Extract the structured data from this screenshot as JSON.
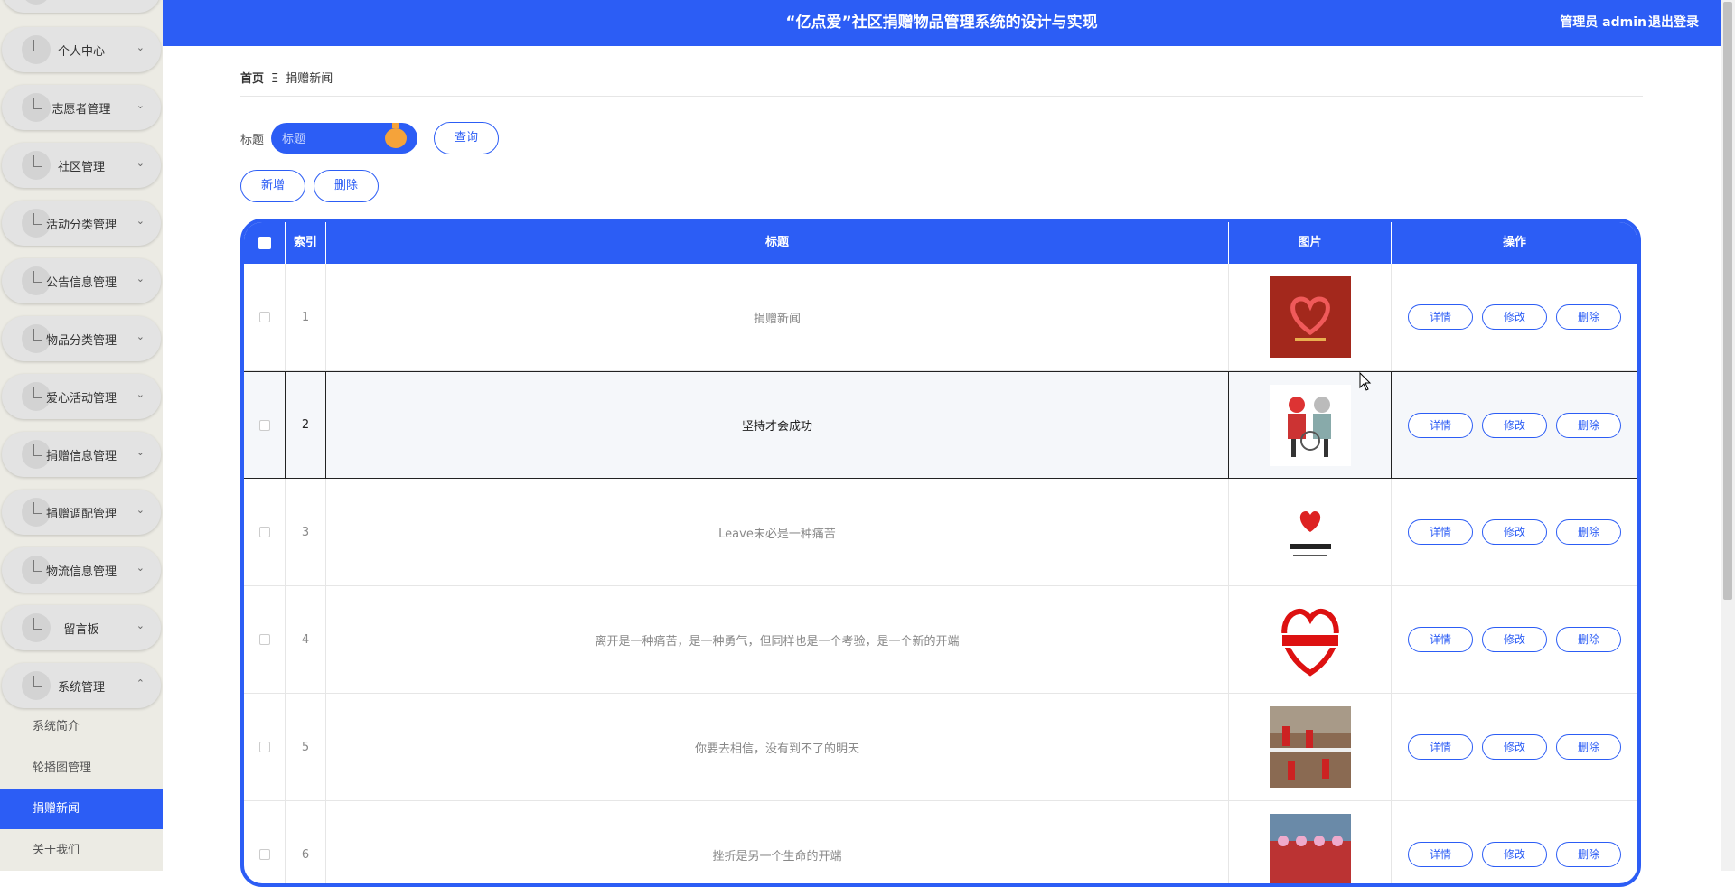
{
  "header": {
    "title": "“亿点爱”社区捐赠物品管理系统的设计与实现",
    "user": "管理员 admin",
    "logout": "退出登录"
  },
  "sidebar": {
    "items": [
      {
        "label": "个人中心",
        "chevron": "⌄"
      },
      {
        "label": "志愿者管理",
        "chevron": "⌄"
      },
      {
        "label": "社区管理",
        "chevron": "⌄"
      },
      {
        "label": "活动分类管理",
        "chevron": "⌄"
      },
      {
        "label": "公告信息管理",
        "chevron": "⌄"
      },
      {
        "label": "物品分类管理",
        "chevron": "⌄"
      },
      {
        "label": "爱心活动管理",
        "chevron": "⌄"
      },
      {
        "label": "捐赠信息管理",
        "chevron": "⌄"
      },
      {
        "label": "捐赠调配管理",
        "chevron": "⌄"
      },
      {
        "label": "物流信息管理",
        "chevron": "⌄"
      },
      {
        "label": "留言板",
        "chevron": "⌄"
      },
      {
        "label": "系统管理",
        "chevron": "⌃"
      }
    ],
    "subitems": [
      {
        "label": "系统简介",
        "active": false
      },
      {
        "label": "轮播图管理",
        "active": false
      },
      {
        "label": "捐赠新闻",
        "active": true
      },
      {
        "label": "关于我们",
        "active": false
      }
    ]
  },
  "breadcrumb": {
    "home": "首页",
    "sep": "Ξ",
    "current": "捐赠新闻"
  },
  "search": {
    "label": "标题",
    "placeholder": "标题",
    "button": "查询"
  },
  "toolbar": {
    "add": "新增",
    "delete": "删除"
  },
  "table": {
    "headers": {
      "index": "索引",
      "title": "标题",
      "image": "图片",
      "actions": "操作"
    },
    "action_labels": {
      "detail": "详情",
      "edit": "修改",
      "delete": "删除"
    },
    "rows": [
      {
        "index": "1",
        "title": "捐赠新闻",
        "image_icon": "heart-logo-red-image"
      },
      {
        "index": "2",
        "title": "坚持才会成功",
        "image_icon": "elderly-couple-image"
      },
      {
        "index": "3",
        "title": "Leave未必是一种痛苦",
        "image_icon": "volunteer-association-logo-image"
      },
      {
        "index": "4",
        "title": "离开是一种痛苦，是一种勇气，但同样也是一个考验，是一个新的开端",
        "image_icon": "love-delivery-logo-image"
      },
      {
        "index": "5",
        "title": "你要去相信，没有到不了的明天",
        "image_icon": "volunteers-photo-image"
      },
      {
        "index": "6",
        "title": "挫折是另一个生命的开端",
        "image_icon": "group-photo-image"
      }
    ]
  },
  "colors": {
    "primary": "#2c5df5",
    "accent": "#f5a33a"
  }
}
